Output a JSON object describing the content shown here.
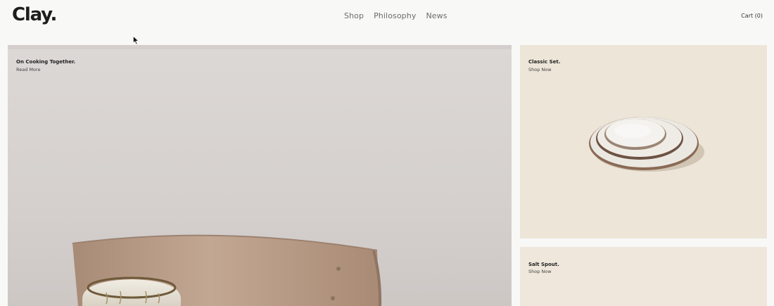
{
  "header": {
    "logo": "Clay.",
    "nav": [
      "Shop",
      "Philosophy",
      "News"
    ],
    "cart": "Cart (0)"
  },
  "cards": {
    "hero": {
      "title": "On Cooking Together.",
      "link": "Read More"
    },
    "classic": {
      "title": "Classic Set.",
      "link": "Shop Now"
    },
    "salt": {
      "title": "Salt Spout.",
      "link": "Shop Now"
    }
  },
  "colors": {
    "background": "#f8f8f7",
    "hero_wall": "#d9d4d2",
    "card_beige": "#ede5d8",
    "chair_wood": "#b79a84"
  }
}
